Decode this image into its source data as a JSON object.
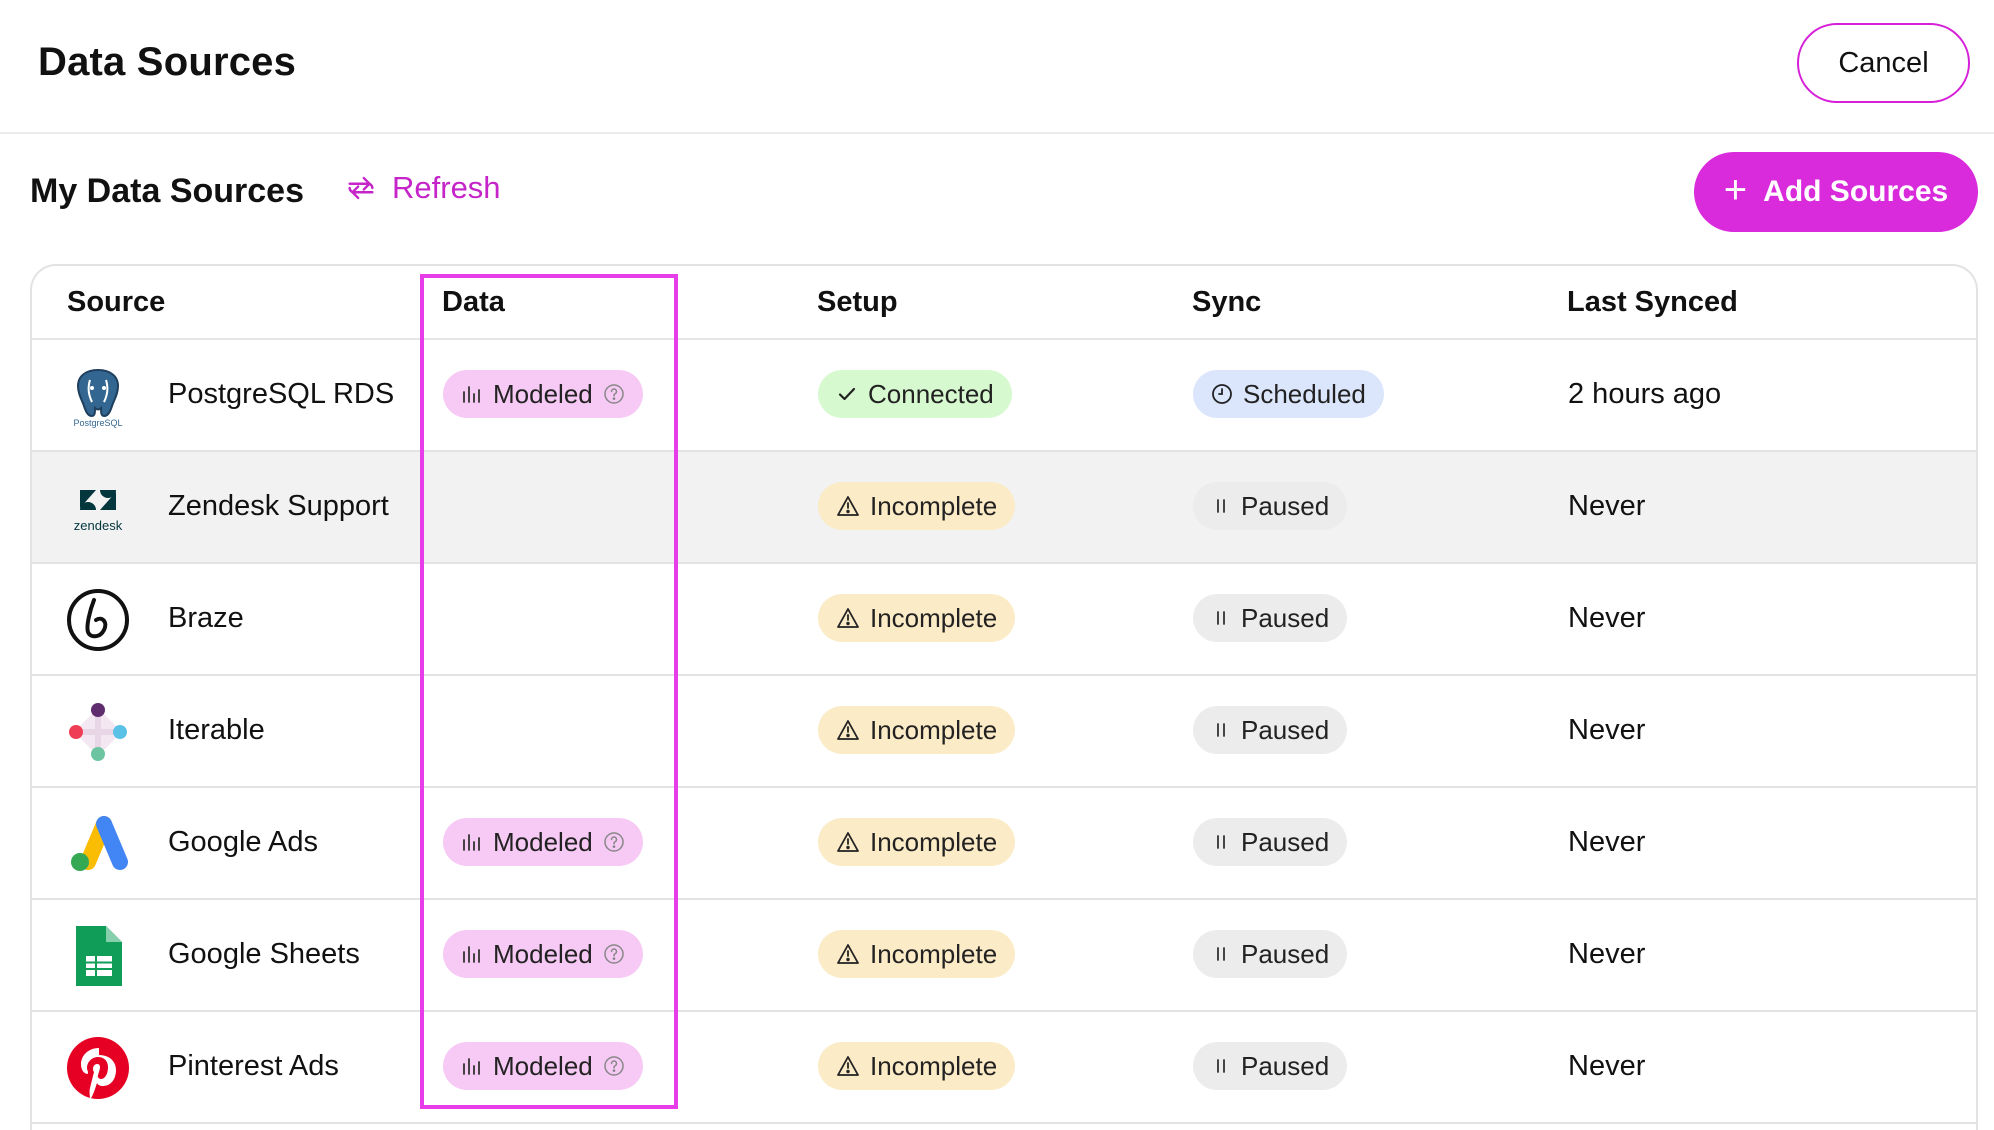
{
  "header": {
    "title": "Data Sources",
    "cancel_label": "Cancel"
  },
  "toolbar": {
    "title": "My Data Sources",
    "refresh_label": "Refresh",
    "add_label": "Add Sources"
  },
  "table": {
    "columns": [
      "Source",
      "Data",
      "Setup",
      "Sync",
      "Last Synced"
    ],
    "rows": [
      {
        "source": "PostgreSQL RDS",
        "logo_text": "PostgreSQL",
        "data": "Modeled",
        "setup": "Connected",
        "sync": "Scheduled",
        "last_synced": "2 hours ago"
      },
      {
        "source": "Zendesk Support",
        "logo_text": "zendesk",
        "data": "",
        "setup": "Incomplete",
        "sync": "Paused",
        "last_synced": "Never"
      },
      {
        "source": "Braze",
        "data": "",
        "setup": "Incomplete",
        "sync": "Paused",
        "last_synced": "Never"
      },
      {
        "source": "Iterable",
        "data": "",
        "setup": "Incomplete",
        "sync": "Paused",
        "last_synced": "Never"
      },
      {
        "source": "Google Ads",
        "data": "Modeled",
        "setup": "Incomplete",
        "sync": "Paused",
        "last_synced": "Never"
      },
      {
        "source": "Google Sheets",
        "data": "Modeled",
        "setup": "Incomplete",
        "sync": "Paused",
        "last_synced": "Never"
      },
      {
        "source": "Pinterest Ads",
        "data": "Modeled",
        "setup": "Incomplete",
        "sync": "Paused",
        "last_synced": "Never"
      }
    ]
  },
  "icons": {
    "refresh": "refresh-icon",
    "add": "plus-icon",
    "modeled": "bar-chart-icon",
    "help": "question-circle-icon",
    "connected": "check-icon",
    "incomplete": "warning-triangle-icon",
    "scheduled": "clock-icon",
    "paused": "pause-icon"
  },
  "colors": {
    "accent": "#d92bdc",
    "modeled_bg": "#f7c9f5",
    "connected_bg": "#d6f9cf",
    "incomplete_bg": "#fbebc7",
    "scheduled_bg": "#dbe5fb",
    "paused_bg": "#ececec",
    "highlight": "#e63de8"
  }
}
